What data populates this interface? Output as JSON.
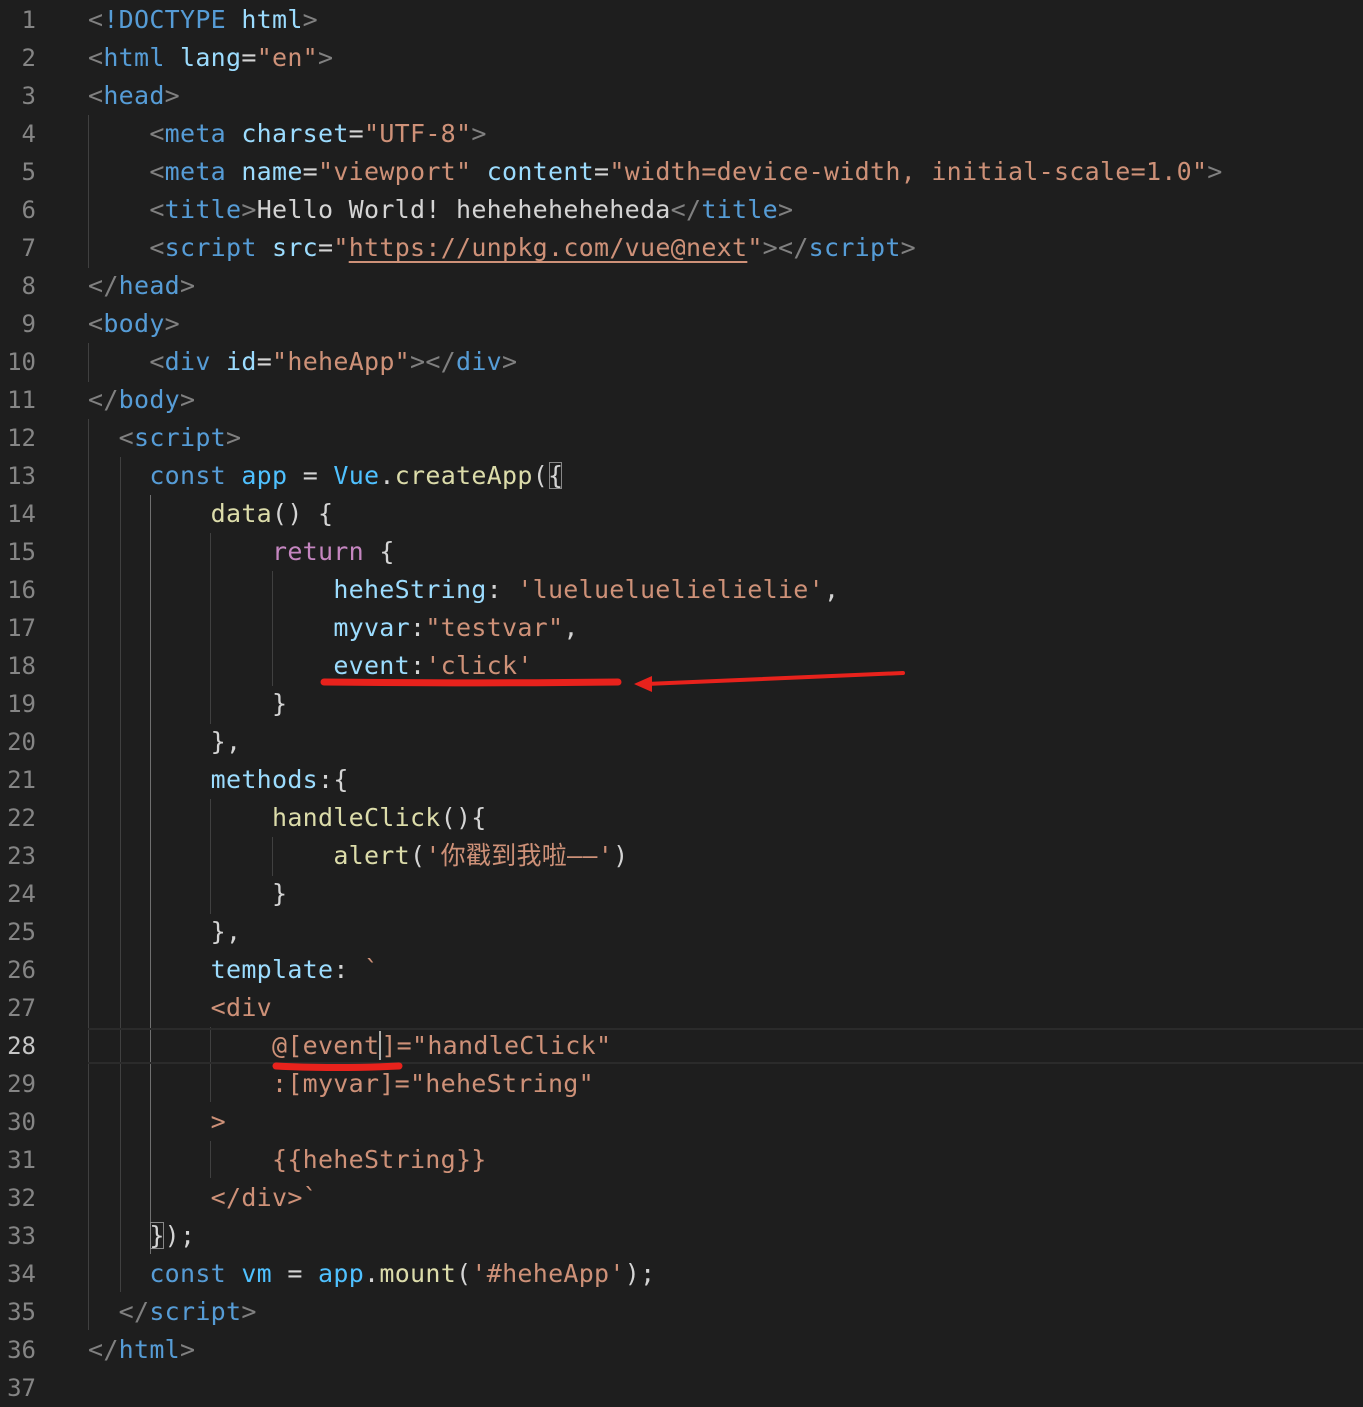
{
  "editor": {
    "language": "html",
    "current_line": 28,
    "theme": {
      "background": "#1e1e1e",
      "annotation_color": "#e8221c"
    },
    "lines": [
      {
        "n": "1",
        "tokens": [
          [
            "punc",
            "<"
          ],
          [
            "tag",
            "!DOCTYPE"
          ],
          [
            "text",
            " "
          ],
          [
            "attr",
            "html"
          ],
          [
            "punc",
            ">"
          ]
        ]
      },
      {
        "n": "2",
        "tokens": [
          [
            "punc",
            "<"
          ],
          [
            "tag",
            "html"
          ],
          [
            "text",
            " "
          ],
          [
            "attr",
            "lang"
          ],
          [
            "op",
            "="
          ],
          [
            "str",
            "\"en\""
          ],
          [
            "punc",
            ">"
          ]
        ]
      },
      {
        "n": "3",
        "tokens": [
          [
            "punc",
            "<"
          ],
          [
            "tag",
            "head"
          ],
          [
            "punc",
            ">"
          ]
        ]
      },
      {
        "n": "4",
        "tokens": [
          [
            "text",
            "    "
          ],
          [
            "punc",
            "<"
          ],
          [
            "tag",
            "meta"
          ],
          [
            "text",
            " "
          ],
          [
            "attr",
            "charset"
          ],
          [
            "op",
            "="
          ],
          [
            "str",
            "\"UTF-8\""
          ],
          [
            "punc",
            ">"
          ]
        ]
      },
      {
        "n": "5",
        "tokens": [
          [
            "text",
            "    "
          ],
          [
            "punc",
            "<"
          ],
          [
            "tag",
            "meta"
          ],
          [
            "text",
            " "
          ],
          [
            "attr",
            "name"
          ],
          [
            "op",
            "="
          ],
          [
            "str",
            "\"viewport\""
          ],
          [
            "text",
            " "
          ],
          [
            "attr",
            "content"
          ],
          [
            "op",
            "="
          ],
          [
            "str",
            "\"width=device-width, initial-scale=1.0\""
          ],
          [
            "punc",
            ">"
          ]
        ]
      },
      {
        "n": "6",
        "tokens": [
          [
            "text",
            "    "
          ],
          [
            "punc",
            "<"
          ],
          [
            "tag",
            "title"
          ],
          [
            "punc",
            ">"
          ],
          [
            "text",
            "Hello World! heheheheheheda"
          ],
          [
            "punc",
            "</"
          ],
          [
            "tag",
            "title"
          ],
          [
            "punc",
            ">"
          ]
        ]
      },
      {
        "n": "7",
        "tokens": [
          [
            "text",
            "    "
          ],
          [
            "punc",
            "<"
          ],
          [
            "tag",
            "script"
          ],
          [
            "text",
            " "
          ],
          [
            "attr",
            "src"
          ],
          [
            "op",
            "="
          ],
          [
            "str",
            "\""
          ],
          [
            "link",
            "https://unpkg.com/vue@next"
          ],
          [
            "str",
            "\""
          ],
          [
            "punc",
            "></"
          ],
          [
            "tag",
            "script"
          ],
          [
            "punc",
            ">"
          ]
        ]
      },
      {
        "n": "8",
        "tokens": [
          [
            "punc",
            "</"
          ],
          [
            "tag",
            "head"
          ],
          [
            "punc",
            ">"
          ]
        ]
      },
      {
        "n": "9",
        "tokens": [
          [
            "punc",
            "<"
          ],
          [
            "tag",
            "body"
          ],
          [
            "punc",
            ">"
          ]
        ]
      },
      {
        "n": "10",
        "tokens": [
          [
            "text",
            "    "
          ],
          [
            "punc",
            "<"
          ],
          [
            "tag",
            "div"
          ],
          [
            "text",
            " "
          ],
          [
            "attr",
            "id"
          ],
          [
            "op",
            "="
          ],
          [
            "str",
            "\"heheApp\""
          ],
          [
            "punc",
            "></"
          ],
          [
            "tag",
            "div"
          ],
          [
            "punc",
            ">"
          ]
        ]
      },
      {
        "n": "11",
        "tokens": [
          [
            "punc",
            "</"
          ],
          [
            "tag",
            "body"
          ],
          [
            "punc",
            ">"
          ]
        ]
      },
      {
        "n": "12",
        "tokens": [
          [
            "text",
            "  "
          ],
          [
            "punc",
            "<"
          ],
          [
            "tag",
            "script"
          ],
          [
            "punc",
            ">"
          ]
        ]
      },
      {
        "n": "13",
        "tokens": [
          [
            "text",
            "    "
          ],
          [
            "kw",
            "const"
          ],
          [
            "text",
            " "
          ],
          [
            "var",
            "app"
          ],
          [
            "text",
            " "
          ],
          [
            "op",
            "="
          ],
          [
            "text",
            " "
          ],
          [
            "var",
            "Vue"
          ],
          [
            "op",
            "."
          ],
          [
            "fn",
            "createApp"
          ],
          [
            "op",
            "("
          ],
          [
            "brk",
            "{"
          ]
        ]
      },
      {
        "n": "14",
        "tokens": [
          [
            "text",
            "        "
          ],
          [
            "fn",
            "data"
          ],
          [
            "op",
            "() {"
          ]
        ]
      },
      {
        "n": "15",
        "tokens": [
          [
            "text",
            "            "
          ],
          [
            "ctrl",
            "return"
          ],
          [
            "op",
            " {"
          ]
        ]
      },
      {
        "n": "16",
        "tokens": [
          [
            "text",
            "                "
          ],
          [
            "prop",
            "heheString"
          ],
          [
            "op",
            ": "
          ],
          [
            "str",
            "'luelueluelielielie'"
          ],
          [
            "op",
            ","
          ]
        ]
      },
      {
        "n": "17",
        "tokens": [
          [
            "text",
            "                "
          ],
          [
            "prop",
            "myvar"
          ],
          [
            "op",
            ":"
          ],
          [
            "str",
            "\"testvar\""
          ],
          [
            "op",
            ","
          ]
        ]
      },
      {
        "n": "18",
        "tokens": [
          [
            "text",
            "                "
          ],
          [
            "prop",
            "event"
          ],
          [
            "op",
            ":"
          ],
          [
            "str",
            "'click'"
          ]
        ]
      },
      {
        "n": "19",
        "tokens": [
          [
            "text",
            "            "
          ],
          [
            "op",
            "}"
          ]
        ]
      },
      {
        "n": "20",
        "tokens": [
          [
            "text",
            "        "
          ],
          [
            "op",
            "},"
          ]
        ]
      },
      {
        "n": "21",
        "tokens": [
          [
            "text",
            "        "
          ],
          [
            "prop",
            "methods"
          ],
          [
            "op",
            ":{"
          ]
        ]
      },
      {
        "n": "22",
        "tokens": [
          [
            "text",
            "            "
          ],
          [
            "fn",
            "handleClick"
          ],
          [
            "op",
            "(){"
          ]
        ]
      },
      {
        "n": "23",
        "tokens": [
          [
            "text",
            "                "
          ],
          [
            "fn",
            "alert"
          ],
          [
            "op",
            "("
          ],
          [
            "str",
            "'你戳到我啦——'"
          ],
          [
            "op",
            ")"
          ]
        ]
      },
      {
        "n": "24",
        "tokens": [
          [
            "text",
            "            "
          ],
          [
            "op",
            "}"
          ]
        ]
      },
      {
        "n": "25",
        "tokens": [
          [
            "text",
            "        "
          ],
          [
            "op",
            "},"
          ]
        ]
      },
      {
        "n": "26",
        "tokens": [
          [
            "text",
            "        "
          ],
          [
            "prop",
            "template"
          ],
          [
            "op",
            ": "
          ],
          [
            "str",
            "`"
          ]
        ]
      },
      {
        "n": "27",
        "tokens": [
          [
            "text",
            "        "
          ],
          [
            "str",
            "<div"
          ]
        ]
      },
      {
        "n": "28",
        "tokens": [
          [
            "text",
            "            "
          ],
          [
            "str",
            "@[even"
          ],
          [
            "cursor",
            "t"
          ],
          [
            "str",
            "]=\"handleClick\""
          ]
        ]
      },
      {
        "n": "29",
        "tokens": [
          [
            "text",
            "            "
          ],
          [
            "str",
            ":[myvar]=\"heheString\""
          ]
        ]
      },
      {
        "n": "30",
        "tokens": [
          [
            "text",
            "        "
          ],
          [
            "str",
            ">"
          ]
        ]
      },
      {
        "n": "31",
        "tokens": [
          [
            "text",
            "            "
          ],
          [
            "str",
            "{{heheString}}"
          ]
        ]
      },
      {
        "n": "32",
        "tokens": [
          [
            "text",
            "        "
          ],
          [
            "str",
            "</div>`"
          ]
        ]
      },
      {
        "n": "33",
        "tokens": [
          [
            "text",
            "    "
          ],
          [
            "brk",
            "}"
          ],
          [
            "op",
            ");"
          ]
        ]
      },
      {
        "n": "34",
        "tokens": [
          [
            "text",
            "    "
          ],
          [
            "kw",
            "const"
          ],
          [
            "text",
            " "
          ],
          [
            "var",
            "vm"
          ],
          [
            "text",
            " "
          ],
          [
            "op",
            "="
          ],
          [
            "text",
            " "
          ],
          [
            "var",
            "app"
          ],
          [
            "op",
            "."
          ],
          [
            "fn",
            "mount"
          ],
          [
            "op",
            "("
          ],
          [
            "str",
            "'#heheApp'"
          ],
          [
            "op",
            ");"
          ]
        ]
      },
      {
        "n": "35",
        "tokens": [
          [
            "text",
            "  "
          ],
          [
            "punc",
            "</"
          ],
          [
            "tag",
            "script"
          ],
          [
            "punc",
            ">"
          ]
        ]
      },
      {
        "n": "36",
        "tokens": [
          [
            "punc",
            "</"
          ],
          [
            "tag",
            "html"
          ],
          [
            "punc",
            ">"
          ]
        ]
      },
      {
        "n": "37",
        "tokens": []
      }
    ]
  }
}
